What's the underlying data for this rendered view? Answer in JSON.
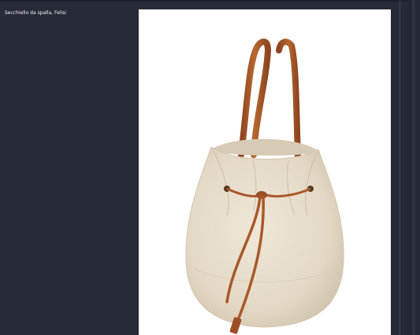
{
  "caption": "Secchiello da spalla, Felisi",
  "image": {
    "subject": "bucket-bag",
    "colors": {
      "background": "#ffffff",
      "shearling": "#e6dccb",
      "leather": "#a9592a"
    }
  },
  "theme": {
    "page_background": "#262b37"
  }
}
